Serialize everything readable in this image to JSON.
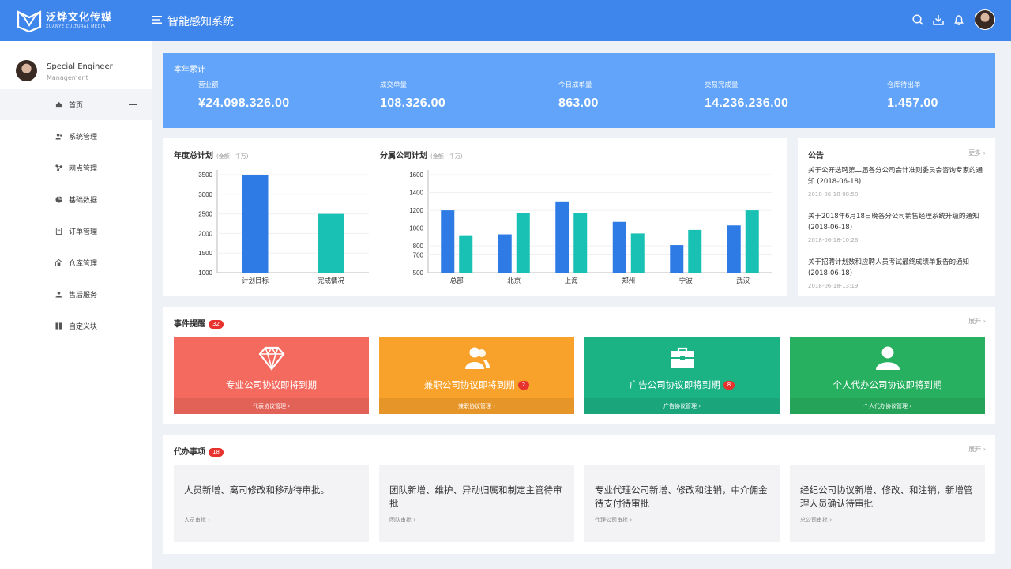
{
  "header": {
    "logo_cn": "泛烨文化传媒",
    "logo_en": "XUANYE CULTURAL MEDIA",
    "app_title": "智能感知系统",
    "icons": [
      "search-icon",
      "download-icon",
      "bell-icon"
    ]
  },
  "sidebar": {
    "user_name": "Special Engineer",
    "user_role": "Management",
    "items": [
      {
        "label": "首页",
        "icon": "home-icon",
        "active": true
      },
      {
        "label": "系统管理",
        "icon": "users-icon"
      },
      {
        "label": "网点管理",
        "icon": "network-icon"
      },
      {
        "label": "基础数据",
        "icon": "pie-icon"
      },
      {
        "label": "订单管理",
        "icon": "order-icon"
      },
      {
        "label": "仓库管理",
        "icon": "warehouse-icon"
      },
      {
        "label": "售后服务",
        "icon": "service-icon"
      },
      {
        "label": "自定义块",
        "icon": "grid-icon"
      }
    ]
  },
  "stats": {
    "title": "本年累计",
    "items": [
      {
        "label": "营业额",
        "value": "¥24.098.326.00"
      },
      {
        "label": "成交单量",
        "value": "108.326.00"
      },
      {
        "label": "今日成单量",
        "value": "863.00"
      },
      {
        "label": "交易完成量",
        "value": "14.236.236.00"
      },
      {
        "label": "仓库待出单",
        "value": "1.457.00"
      }
    ]
  },
  "annual_chart": {
    "title": "年度总计划",
    "unit": "(金额：千万)"
  },
  "branch_chart": {
    "title": "分属公司计划",
    "unit": "(金额：千万)"
  },
  "chart_data": [
    {
      "type": "bar",
      "title": "年度总计划",
      "categories": [
        "计划目标",
        "完成情况"
      ],
      "values": [
        3500,
        2500
      ],
      "colors": [
        "#2e7be6",
        "#19c1b4"
      ],
      "ylim": [
        1000,
        3500
      ],
      "yticks": [
        1000,
        1500,
        2000,
        2500,
        3000,
        3500
      ]
    },
    {
      "type": "bar",
      "title": "分属公司计划",
      "categories": [
        "总部",
        "北京",
        "上海",
        "郑州",
        "宁波",
        "武汉"
      ],
      "series": [
        {
          "values": [
            1200,
            930,
            1300,
            1070,
            810,
            1030
          ],
          "color": "#2e7be6"
        },
        {
          "values": [
            920,
            1170,
            1170,
            940,
            980,
            1200
          ],
          "color": "#19c1b4"
        }
      ],
      "ylim": [
        500,
        1600
      ],
      "yticks": [
        500,
        700,
        800,
        1000,
        1200,
        1400,
        1600
      ]
    }
  ],
  "notice": {
    "title": "公告",
    "more": "更多",
    "items": [
      {
        "text": "关于公开选聘第二届各分公司会计准则委员会咨询专家的通知 (2018-06-18)",
        "time": "2018-06-18-08:58"
      },
      {
        "text": "关于2018年6月18日晚各分公司销售经理系统升级的通知 (2018-06-18)",
        "time": "2018-06-18-10:26"
      },
      {
        "text": "关于招聘计划数和应聘人员考试最终成绩单报告的通知 (2018-06-18)",
        "time": "2018-06-18-13:19"
      }
    ]
  },
  "events": {
    "title": "事件提醒",
    "count": "32",
    "expand": "展开",
    "cards": [
      {
        "title": "专业公司协议即将到期",
        "badge": "",
        "link": "代表协议管理",
        "color": "#f46a5e",
        "icon": "diamond-icon"
      },
      {
        "title": "兼职公司协议即将到期",
        "badge": "2",
        "link": "兼职协议管理",
        "color": "#f8a22c",
        "icon": "team-icon"
      },
      {
        "title": "广告公司协议即将到期",
        "badge": "8",
        "link": "广告协议管理",
        "color": "#1cb384",
        "icon": "briefcase-icon"
      },
      {
        "title": "个人代办公司协议即将到期",
        "badge": "",
        "link": "个人代办协议管理",
        "color": "#27b060",
        "icon": "person-icon"
      }
    ]
  },
  "todos": {
    "title": "代办事项",
    "count": "18",
    "expand": "展开",
    "cards": [
      {
        "text": "人员新增、离司修改和移动待审批。",
        "link": "人员审批"
      },
      {
        "text": "团队新增、维护、异动归属和制定主管待审批",
        "link": "团队审批"
      },
      {
        "text": "专业代理公司新增、修改和注销，中介佣金待支付待审批",
        "link": "代理公司审批"
      },
      {
        "text": "经纪公司协议新增、修改、和注销，新增管理人员确认待审批",
        "link": "总公司审批"
      }
    ]
  }
}
